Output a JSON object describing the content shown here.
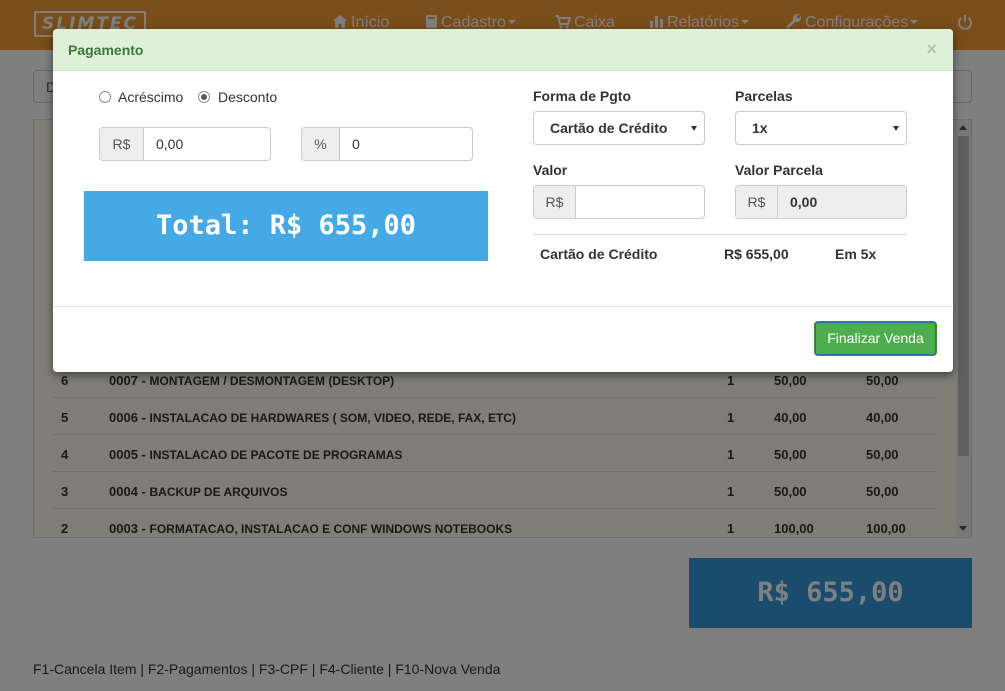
{
  "navbar": {
    "brand": "SLIMTEC",
    "items": [
      {
        "label": "Início",
        "icon": "home-icon"
      },
      {
        "label": "Cadastro",
        "icon": "book-icon"
      },
      {
        "label": "Caixa",
        "icon": "cart-icon"
      },
      {
        "label": "Relatórios",
        "icon": "bar-chart-icon"
      },
      {
        "label": "Configurações",
        "icon": "wrench-icon"
      }
    ],
    "power_icon": "power-icon",
    "color": "#f39c34"
  },
  "filter": {
    "text": "D"
  },
  "items": [
    {
      "n": "6",
      "code": "0007 - ",
      "desc": "MONTAGEM / DESMONTAGEM (DESKTOP)",
      "qty": "1",
      "unit": "50,00",
      "total": "50,00"
    },
    {
      "n": "5",
      "code": "0006 - ",
      "desc": "INSTALACAO DE HARDWARES ( SOM, VIDEO, REDE, FAX, ETC)",
      "qty": "1",
      "unit": "40,00",
      "total": "40,00"
    },
    {
      "n": "4",
      "code": "0005 - ",
      "desc": "INSTALACAO DE PACOTE DE PROGRAMAS",
      "qty": "1",
      "unit": "50,00",
      "total": "50,00"
    },
    {
      "n": "3",
      "code": "0004 - ",
      "desc": "BACKUP DE ARQUIVOS",
      "qty": "1",
      "unit": "50,00",
      "total": "50,00"
    },
    {
      "n": "2",
      "code": "0003 - ",
      "desc": "FORMATACAO, INSTALACAO E CONF WINDOWS NOTEBOOKS",
      "qty": "1",
      "unit": "100,00",
      "total": "100,00"
    }
  ],
  "grand_total": "R$ 655,00",
  "shortcuts": "F1-Cancela Item | F2-Pagamentos | F3-CPF | F4-Cliente | F10-Nova Venda",
  "modal": {
    "title": "Pagamento",
    "close": "×",
    "adjust": {
      "option_increase": "Acréscimo",
      "option_discount": "Desconto",
      "selected": "Desconto",
      "currency_addon": "R$",
      "currency_value": "0,00",
      "percent_addon": "%",
      "percent_value": "0"
    },
    "total_label": "Total: R$ 655,00",
    "form": {
      "method_label": "Forma de Pgto",
      "method_value": "Cartão de Crédito",
      "installments_label": "Parcelas",
      "installments_value": "1x",
      "value_label": "Valor",
      "value_addon": "R$",
      "value_value": "",
      "installment_value_label": "Valor Parcela",
      "installment_value_addon": "R$",
      "installment_value_value": "0,00"
    },
    "payment_line": {
      "method": "Cartão de Crédito",
      "amount": "R$ 655,00",
      "installments": "Em 5x"
    },
    "finish_button": "Finalizar Venda"
  }
}
